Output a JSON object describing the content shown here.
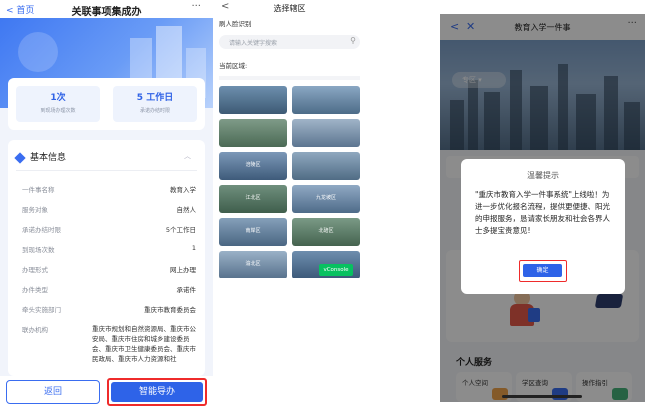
{
  "panel1": {
    "back_label": "首页",
    "title": "关联事项集成办",
    "more": "···",
    "stats": [
      {
        "value": "1次",
        "label": "到现场办理次数"
      },
      {
        "value": "5 工作日",
        "label": "承诺办结时限"
      }
    ],
    "card_title": "基本信息",
    "rows": [
      {
        "key": "一件事名称",
        "value": "教育入学"
      },
      {
        "key": "服务对象",
        "value": "自然人"
      },
      {
        "key": "承诺办结时限",
        "value": "5个工作日"
      },
      {
        "key": "到现场次数",
        "value": "1"
      },
      {
        "key": "办理形式",
        "value": "网上办理"
      },
      {
        "key": "办件类型",
        "value": "承诺件"
      },
      {
        "key": "牵头实施部门",
        "value": "重庆市教育委员会"
      },
      {
        "key": "联办机构",
        "value": "重庆市规划和自然资源局、重庆市公安局、重庆市住房和城乡建设委员会、重庆市卫生健康委员会、重庆市民政局、重庆市人力资源和社"
      }
    ],
    "btn_back": "返回",
    "btn_guide": "智能导办"
  },
  "panel2": {
    "back": "<",
    "title": "选择辖区",
    "face_label": "刷人脸识别",
    "search_placeholder": "请输入关键字搜索",
    "current_label": "当前区域:",
    "tiles": [
      "",
      "",
      "",
      "",
      "涪陵区",
      "",
      "江北区",
      "九龙坡区",
      "南岸区",
      "北碚区",
      "渝北区",
      "",
      "",
      "",
      "",
      ""
    ],
    "vconsole": "vConsole"
  },
  "panel3": {
    "title": "教育入学一件事",
    "more": "···",
    "area_pill": "专区",
    "section_title": "个人服务",
    "services": [
      "个人空间",
      "学区查询",
      "操作指引"
    ],
    "dialog": {
      "title": "温馨提示",
      "message": "\"重庆市教育入学一件事系统\"上线啦！为进一步优化报名流程，提供更便捷、阳光的申报服务，恳请家长朋友和社会各界人士多提宝贵意见!",
      "ok": "确定"
    }
  },
  "colors": {
    "accent": "#2e63e8",
    "highlight": "#ef2b2b"
  }
}
